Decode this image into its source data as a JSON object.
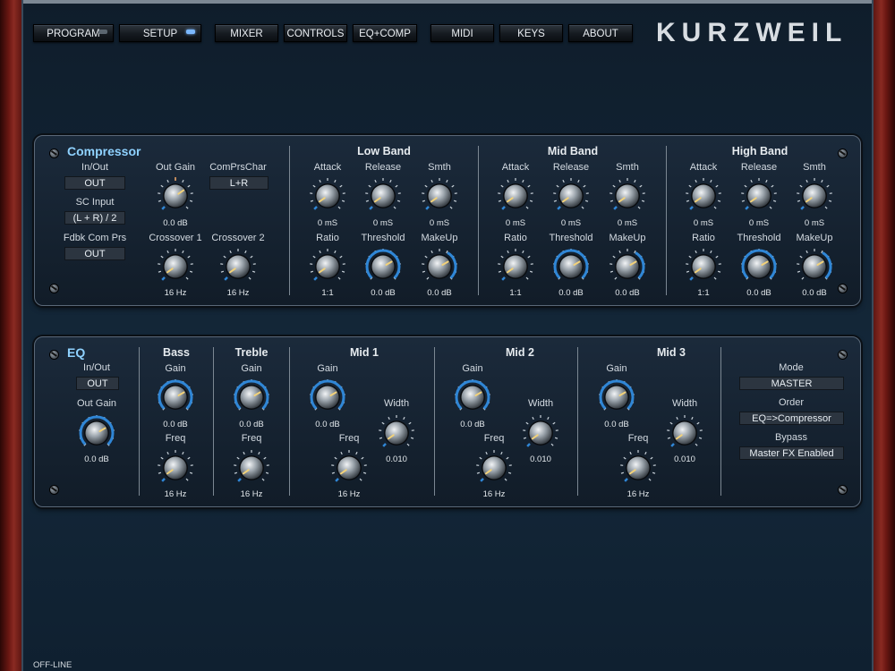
{
  "nav": {
    "buttons": [
      "PROGRAM",
      "SETUP",
      "MIXER",
      "CONTROLS",
      "EQ+COMP",
      "MIDI",
      "KEYS",
      "ABOUT"
    ],
    "brand": "KURZWEIL"
  },
  "compressor": {
    "title": "Compressor",
    "in_out_label": "In/Out",
    "in_out_value": "OUT",
    "sc_input_label": "SC Input",
    "sc_input_value": "(L + R) / 2",
    "fdbk_label": "Fdbk Com Prs",
    "fdbk_value": "OUT",
    "out_gain_label": "Out Gain",
    "out_gain_value": "0.0 dB",
    "comprschar_label": "ComPrsChar",
    "comprschar_value": "L+R",
    "crossover1_label": "Crossover 1",
    "crossover1_value": "16 Hz",
    "crossover2_label": "Crossover 2",
    "crossover2_value": "16 Hz",
    "bands": [
      {
        "name": "Low Band",
        "attack": "Attack",
        "attack_v": "0 mS",
        "release": "Release",
        "release_v": "0 mS",
        "smth": "Smth",
        "smth_v": "0 mS",
        "ratio": "Ratio",
        "ratio_v": "1:1",
        "threshold": "Threshold",
        "threshold_v": "0.0 dB",
        "makeup": "MakeUp",
        "makeup_v": "0.0 dB"
      },
      {
        "name": "Mid Band",
        "attack": "Attack",
        "attack_v": "0 mS",
        "release": "Release",
        "release_v": "0 mS",
        "smth": "Smth",
        "smth_v": "0 mS",
        "ratio": "Ratio",
        "ratio_v": "1:1",
        "threshold": "Threshold",
        "threshold_v": "0.0 dB",
        "makeup": "MakeUp",
        "makeup_v": "0.0 dB"
      },
      {
        "name": "High Band",
        "attack": "Attack",
        "attack_v": "0 mS",
        "release": "Release",
        "release_v": "0 mS",
        "smth": "Smth",
        "smth_v": "0 mS",
        "ratio": "Ratio",
        "ratio_v": "1:1",
        "threshold": "Threshold",
        "threshold_v": "0.0 dB",
        "makeup": "MakeUp",
        "makeup_v": "0.0 dB"
      }
    ]
  },
  "eq": {
    "title": "EQ",
    "in_out_label": "In/Out",
    "in_out_value": "OUT",
    "out_gain_label": "Out Gain",
    "out_gain_value": "0.0 dB",
    "bass": {
      "name": "Bass",
      "gain": "Gain",
      "gain_v": "0.0 dB",
      "freq": "Freq",
      "freq_v": "16 Hz"
    },
    "treble": {
      "name": "Treble",
      "gain": "Gain",
      "gain_v": "0.0 dB",
      "freq": "Freq",
      "freq_v": "16 Hz"
    },
    "mids": [
      {
        "name": "Mid 1",
        "gain": "Gain",
        "gain_v": "0.0 dB",
        "width": "Width",
        "width_v": "0.010",
        "freq": "Freq",
        "freq_v": "16 Hz"
      },
      {
        "name": "Mid 2",
        "gain": "Gain",
        "gain_v": "0.0 dB",
        "width": "Width",
        "width_v": "0.010",
        "freq": "Freq",
        "freq_v": "16 Hz"
      },
      {
        "name": "Mid 3",
        "gain": "Gain",
        "gain_v": "0.0 dB",
        "width": "Width",
        "width_v": "0.010",
        "freq": "Freq",
        "freq_v": "16 Hz"
      }
    ],
    "mode_label": "Mode",
    "mode_value": "MASTER",
    "order_label": "Order",
    "order_value": "EQ=>Compressor",
    "bypass_label": "Bypass",
    "bypass_value": "Master FX Enabled"
  },
  "status": "OFF-LINE",
  "colors": {
    "accent": "#8fd2ff",
    "led_on": "#7bb8ff",
    "arc": "#2f86d6",
    "pointer": "#f2d27a"
  }
}
